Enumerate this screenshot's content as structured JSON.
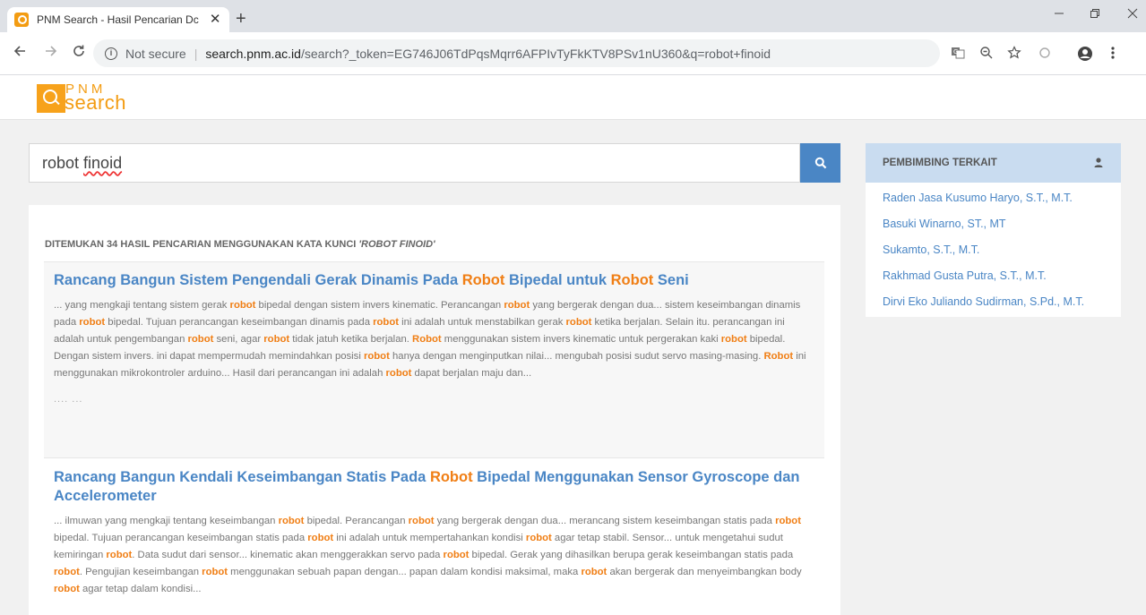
{
  "browser": {
    "tab_title": "PNM Search - Hasil Pencarian Dc",
    "tab_close": "✕",
    "new_tab": "+",
    "security_label": "Not secure",
    "url_host": "search.pnm.ac.id",
    "url_path": "/search?_token=EG746J06TdPqsMqrr6AFPIvTyFkKTV8PSv1nU360&q=robot+finoid"
  },
  "site": {
    "logo_top": "PNM",
    "logo_bottom": "search"
  },
  "search": {
    "query_word1": "robot",
    "query_word2": "finoid"
  },
  "results": {
    "summary_prefix": "DITEMUKAN 34 HASIL PENCARIAN MENGGUNAKAN KATA KUNCI",
    "summary_keyword": "'ROBOT FINOID'",
    "items": [
      {
        "title": "Rancang Bangun Sistem Pengendali Gerak Dinamis Pada Robot Bipedal untuk Robot Seni",
        "snippet": "... yang mengkaji tentang sistem gerak robot bipedal dengan sistem invers kinematic. Perancangan robot yang bergerak dengan dua... sistem keseimbangan dinamis pada robot bipedal. Tujuan perancangan keseimbangan dinamis pada robot ini adalah untuk menstabilkan gerak robot ketika berjalan. Selain itu. perancangan ini adalah untuk pengembangan robot seni, agar robot tidak jatuh ketika berjalan. Robot menggunakan sistem invers kinematic untuk pergerakan kaki robot bipedal. Dengan sistem invers. ini dapat mempermudah memindahkan posisi robot hanya dengan menginputkan nilai... mengubah posisi sudut servo masing-masing. Robot ini menggunakan mikrokontroler arduino... Hasil dari perancangan ini adalah robot dapat berjalan maju dan...",
        "extra": "....   ..."
      },
      {
        "title": "Rancang Bangun Kendali Keseimbangan Statis Pada Robot Bipedal Menggunakan Sensor Gyroscope dan Accelerometer",
        "snippet": "... ilmuwan yang mengkaji tentang keseimbangan robot bipedal. Perancangan robot yang bergerak dengan dua... merancang sistem keseimbangan statis pada robot bipedal. Tujuan perancangan keseimbangan statis pada robot ini adalah untuk mempertahankan kondisi robot agar tetap stabil. Sensor... untuk mengetahui sudut kemiringan robot. Data sudut dari sensor... kinematic akan menggerakkan servo pada robot bipedal. Gerak yang dihasilkan berupa gerak keseimbangan statis pada robot. Pengujian keseimbangan robot menggunakan sebuah papan dengan... papan dalam kondisi maksimal, maka robot akan bergerak dan menyeimbangkan body robot agar tetap dalam kondisi..."
      }
    ]
  },
  "panel": {
    "title": "PEMBIMBING TERKAIT",
    "items": [
      "Raden Jasa Kusumo Haryo, S.T., M.T.",
      "Basuki Winarno, ST., MT",
      "Sukamto, S.T., M.T.",
      "Rakhmad Gusta Putra, S.T., M.T.",
      "Dirvi Eko Juliando Sudirman, S.Pd., M.T."
    ]
  },
  "colors": {
    "accent": "#4a86c5",
    "keyword": "#f07e14",
    "logo": "#f39c12",
    "panel_header": "#c9dcf0"
  }
}
